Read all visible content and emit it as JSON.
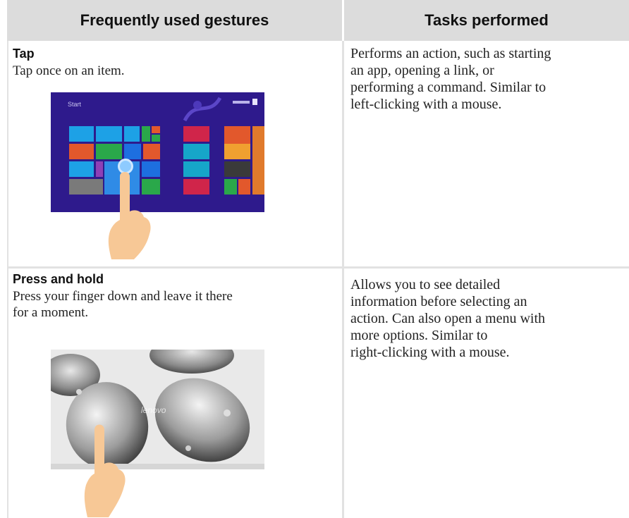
{
  "header": {
    "col1": "Frequently used gestures",
    "col2": "Tasks performed"
  },
  "rows": [
    {
      "title": "Tap",
      "description": "Tap once on an item.",
      "task_lines": [
        "Performs an action, such as starting",
        "an app, opening a link, or",
        "performing a command. Similar to",
        "left-clicking with a mouse."
      ],
      "illustration": "windows-start-screen-with-finger-tap"
    },
    {
      "title": "Press and hold",
      "description_lines": [
        "Press your finger down and leave it there",
        "for a moment."
      ],
      "task_lines": [
        "Allows you to see detailed",
        "information before selecting an",
        "action. Can also open a menu with",
        "more options. Similar to",
        "right-clicking with a mouse."
      ],
      "illustration": "stones-wallpaper-with-finger-press"
    }
  ],
  "illustration_text": {
    "start_label": "Start",
    "brand_watermark": "lenovo"
  },
  "colors": {
    "header_bg": "#dcdcdc",
    "rule": "#e2e2e2",
    "start_screen_bg": "#2e1a8c",
    "finger": "#f7c896"
  }
}
